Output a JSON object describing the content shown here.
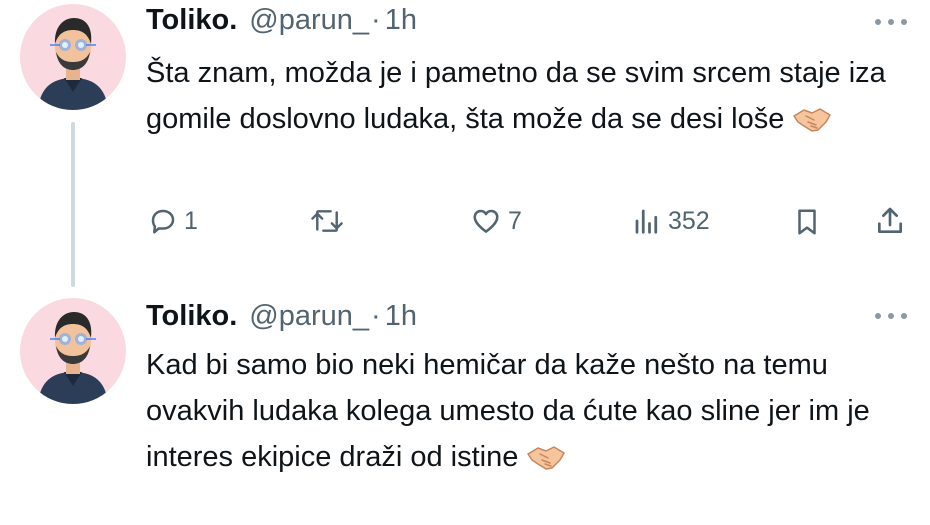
{
  "tweets": [
    {
      "author_name": "Toliko.",
      "handle": "@parun_",
      "separator": "·",
      "time": "1h",
      "text": "Šta znam, možda je i pametno da se svim srcem staje iza gomile doslovno ludaka, šta može da se desi loše",
      "emoji_icon": "handshake-icon",
      "actions": {
        "reply_count": "1",
        "retweet_count": "",
        "like_count": "7",
        "views_count": "352"
      }
    },
    {
      "author_name": "Toliko.",
      "handle": "@parun_",
      "separator": "·",
      "time": "1h",
      "text": "Kad bi samo bio neki hemičar da kaže nešto na temu ovakvih ludaka kolega umesto da ćute kao sline jer im je interes ekipice draži od istine",
      "emoji_icon": "handshake-icon"
    }
  ],
  "colors": {
    "avatar_bg": "#fbd9e1",
    "secondary_text": "#536471",
    "thread_line": "#cfd9de"
  }
}
